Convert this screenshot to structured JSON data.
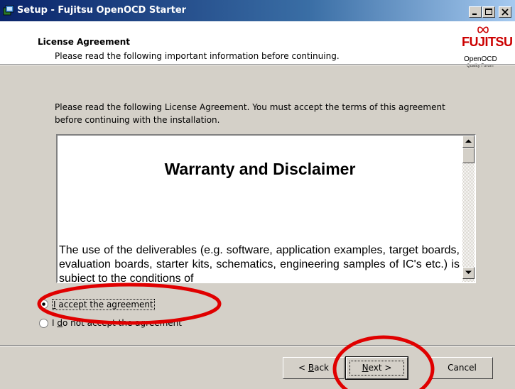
{
  "window": {
    "title": "Setup - Fujitsu OpenOCD Starter",
    "icon": "setup-icon",
    "controls": [
      "minimize-icon",
      "maximize-icon",
      "close-icon"
    ]
  },
  "header": {
    "title": "License Agreement",
    "subtitle": "Please read the following important information before continuing.",
    "logo": {
      "brand": "FUJITSU",
      "product": "OpenOCD",
      "tagline": "Quality Forum"
    }
  },
  "intro_text": "Please read the following License Agreement. You must accept the terms of this agreement before continuing with the installation.",
  "license": {
    "heading": "Warranty and Disclaimer",
    "body": "The use of the deliverables (e.g. software, application examples, target boards, evaluation boards, starter kits, schematics, engineering samples of IC's etc.) is subject to the conditions of"
  },
  "options": {
    "accept": {
      "label_access_key": "I",
      "label_rest": " accept the agreement",
      "selected": true
    },
    "decline": {
      "label_prefix": "I ",
      "label_access_key": "d",
      "label_rest": "o not accept the agreement",
      "selected": false
    }
  },
  "buttons": {
    "back": {
      "prefix": "< ",
      "access_key": "B",
      "rest": "ack"
    },
    "next": {
      "access_key": "N",
      "rest": "ext >"
    },
    "cancel": {
      "label": "Cancel"
    }
  },
  "colors": {
    "titlebar_start": "#0a246a",
    "titlebar_end": "#a6caf0",
    "dialog_bg": "#d4d0c8",
    "brand_red": "#cc0000",
    "annotation_red": "#e00000"
  }
}
